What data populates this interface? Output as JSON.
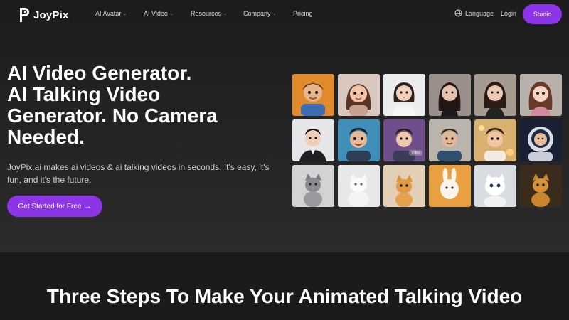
{
  "brand": {
    "name": "JoyPix",
    "accent": "#8c34e8"
  },
  "nav": {
    "items": [
      {
        "label": "AI Avatar",
        "has_dropdown": true
      },
      {
        "label": "AI Video",
        "has_dropdown": true
      },
      {
        "label": "Resources",
        "has_dropdown": true
      },
      {
        "label": "Company",
        "has_dropdown": true
      },
      {
        "label": "Pricing",
        "has_dropdown": false
      }
    ],
    "language_label": "Language",
    "language_icon": "globe-icon",
    "login_label": "Login",
    "studio_label": "Studio"
  },
  "hero": {
    "headline_lines": [
      "AI Video Generator.",
      "AI Talking Video",
      "Generator. No Camera",
      "Needed."
    ],
    "subtext": "JoyPix.ai makes ai videos & ai talking videos in seconds. It's easy, it's fun, and it's the future.",
    "cta_label": "Get Started for Free",
    "cta_arrow": "→"
  },
  "avatar_grid": {
    "tile_badge": "Video",
    "rows": [
      [
        "cartoon-boy-avatar",
        "cartoon-girl-avatar",
        "business-woman-avatar",
        "woman-portrait-avatar",
        "young-woman-avatar",
        "anime-girl-avatar"
      ],
      [
        "man-in-suit-avatar",
        "cartoon-man-avatar",
        "young-man-avatar",
        "smiling-man-avatar",
        "cartoon-boy-golden-avatar",
        "astronaut-avatar"
      ],
      [
        "gray-cat-avatar",
        "white-cat-avatar",
        "orange-kitten-avatar",
        "white-bunny-avatar",
        "fluffy-white-cat-avatar",
        "ginger-cat-avatar"
      ]
    ]
  },
  "section": {
    "title": "Three Steps To Make Your Animated Talking Video"
  }
}
